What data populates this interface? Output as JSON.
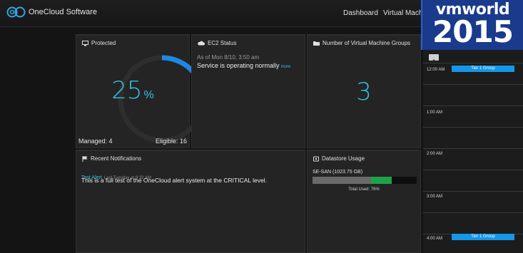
{
  "app": {
    "brand": "OneCloud Software"
  },
  "nav": {
    "dashboard": "Dashboard",
    "virtual_machines": "Virtual Machi"
  },
  "watermark": {
    "brand": "vmworld",
    "year": "2015"
  },
  "protected": {
    "title": "Protected",
    "percent": "25",
    "percent_symbol": "%",
    "managed": "Managed: 4",
    "eligible": "Eligible: 16"
  },
  "ec2": {
    "title": "EC2 Status",
    "as_of": "As of Mon 8/10, 3:50 am",
    "status": "Service is operating normally",
    "more": "more"
  },
  "vm_groups": {
    "title": "Number of Virtual Machine Groups",
    "count": "3"
  },
  "notifications": {
    "title": "Recent Notifications",
    "items": [
      {
        "link": "Test Alert",
        "time": "Last Tuesday at 9:32 AM",
        "message": "This is a full test of the OneCloud alert system at the CRITICAL level."
      }
    ]
  },
  "datastore": {
    "title": "Datastore Usage",
    "name": "SE-SAN (1023.75 GB)",
    "used_fraction": 0.76,
    "total_used": "Total Used: 76%"
  },
  "schedule": {
    "slots": [
      "12:00 AM",
      "1:00 AM",
      "2:00 AM",
      "3:00 AM",
      "4:00 AM"
    ],
    "events": [
      "Tier 1 Group",
      "Tier 1 Group"
    ]
  },
  "colors": {
    "accent": "#33c1e0",
    "usage_green": "#1ea34a",
    "event_blue": "#1596e8"
  }
}
